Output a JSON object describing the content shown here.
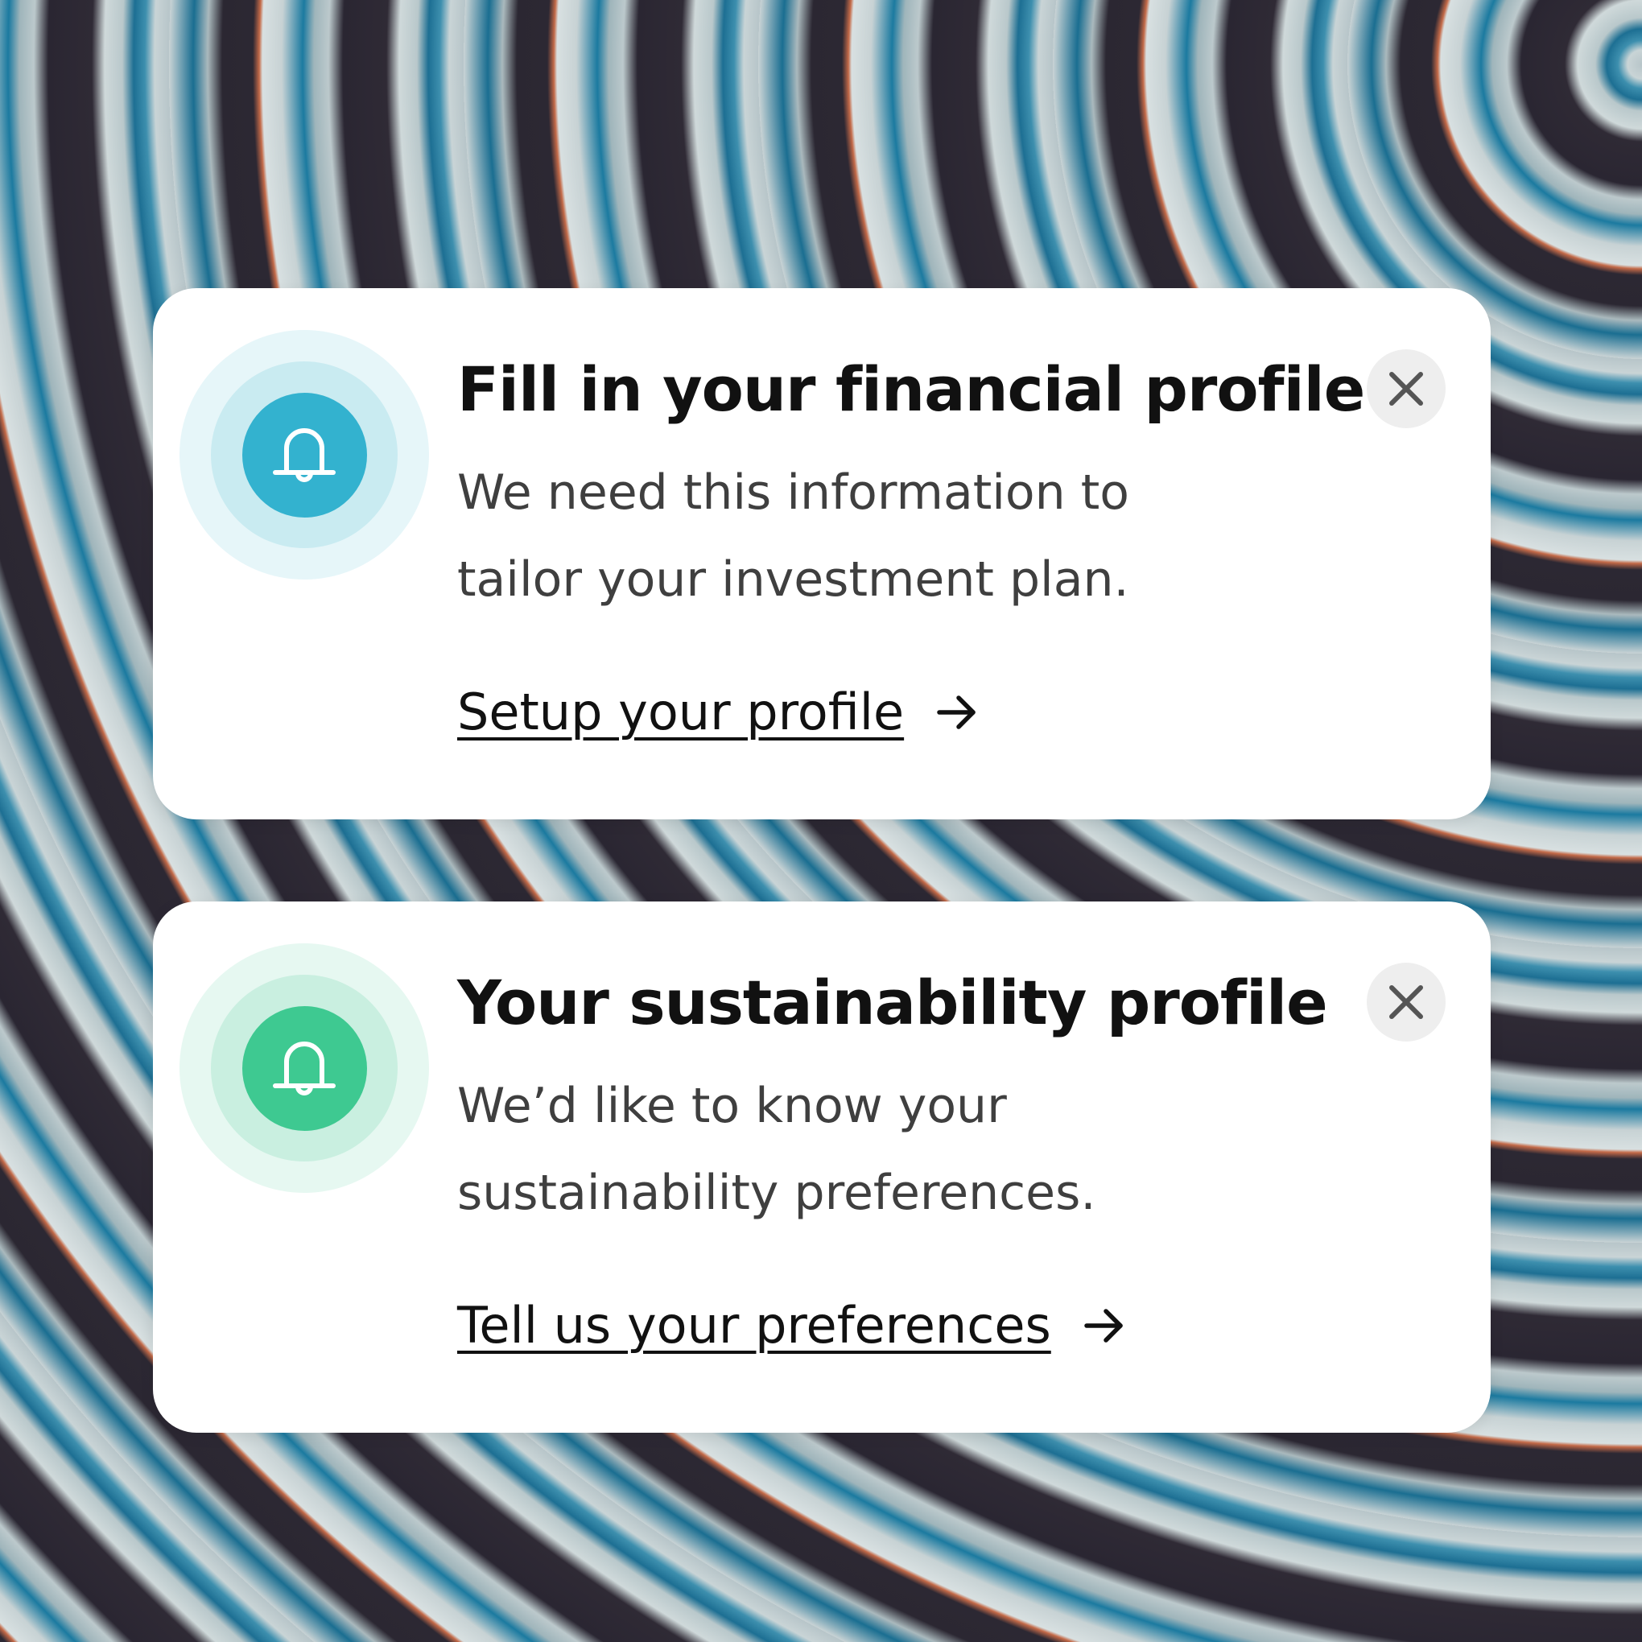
{
  "colors": {
    "card_background": "#ffffff",
    "title_text": "#111111",
    "body_text": "#3f3f3f",
    "close_button_background": "#eeeeee",
    "close_icon": "#555555"
  },
  "cards": [
    {
      "title": "Fill in your financial profile",
      "description_lines": [
        "We need this information to",
        "tailor your investment plan."
      ],
      "cta_label": "Setup your profile",
      "cta_icon": "arrow-right-icon",
      "badge_icon": "bell-icon",
      "close_icon": "close-icon",
      "badge_colors": {
        "outer": "#e6f6f9",
        "middle": "#c9ebf1",
        "inner": "#33b2cf"
      }
    },
    {
      "title": "Your sustainability profile",
      "description_lines": [
        "We’d like to know your",
        "sustainability preferences."
      ],
      "cta_label": "Tell us your preferences",
      "cta_icon": "arrow-right-icon",
      "badge_icon": "bell-icon",
      "close_icon": "close-icon",
      "badge_colors": {
        "outer": "#e6f8f1",
        "middle": "#c9efe0",
        "inner": "#3ec991"
      }
    }
  ]
}
